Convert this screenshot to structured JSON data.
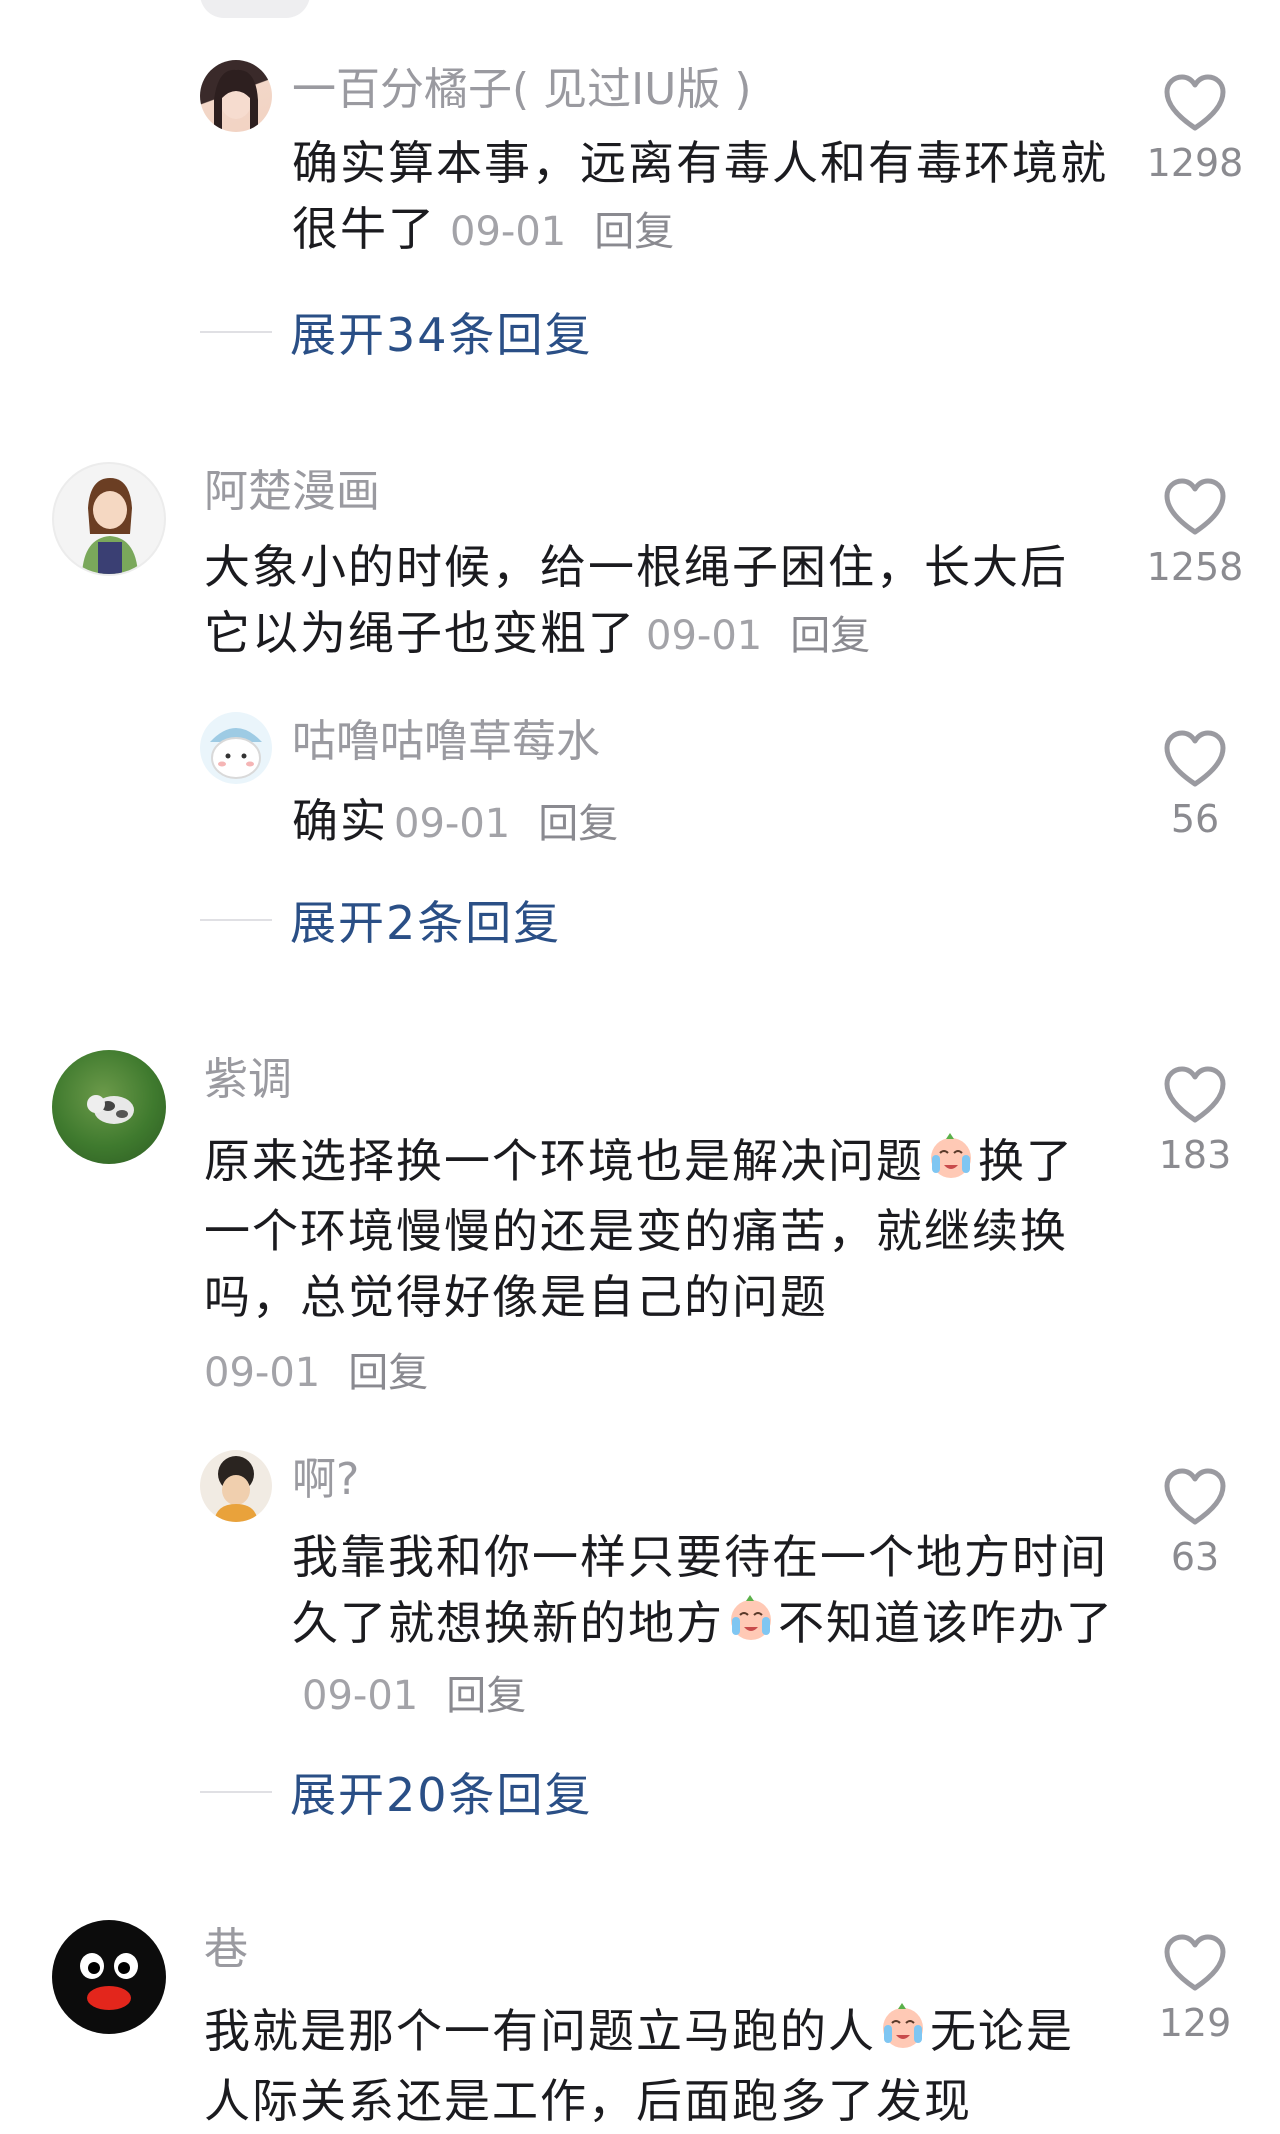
{
  "comments": [
    {
      "name": "一百分橘子( 见过IU版 )",
      "text": "确实算本事，远离有毒人和有毒环境就很牛了",
      "date": "09-01",
      "reply": "回复",
      "likes": "1298",
      "expand": "展开34条回复"
    },
    {
      "name": "阿楚漫画",
      "text": "大象小的时候，给一根绳子困住，长大后它以为绳子也变粗了",
      "date": "09-01",
      "reply": "回复",
      "likes": "1258",
      "sub": {
        "name": "咕噜咕噜草莓水",
        "text": "确实",
        "date": "09-01",
        "reply": "回复",
        "likes": "56"
      },
      "expand": "展开2条回复"
    },
    {
      "name": "紫调",
      "text_a": "原来选择换一个环境也是解决问题",
      "text_b": "换了一个环境慢慢的还是变的痛苦，就继续换吗，总觉得好像是自己的问题",
      "date": "09-01",
      "reply": "回复",
      "likes": "183",
      "sub": {
        "name": "啊?",
        "text_a": "我靠我和你一样只要待在一个地方时间久了就想换新的地方",
        "text_b": "不知道该咋办了",
        "date": "09-01",
        "reply": "回复",
        "likes": "63"
      },
      "expand": "展开20条回复"
    },
    {
      "name": "巷",
      "text_a": "我就是那个一有问题立马跑的人",
      "text_b": "无论是人际关系还是工作，后面跑多了发现",
      "likes": "129"
    }
  ],
  "icons": {
    "like": "heart-outline-icon",
    "emoji1": "crying-emoji",
    "emoji2": "crying-emoji"
  },
  "colors": {
    "expand_link": "#2a4f86",
    "meta_text": "#a3a3a8",
    "heart_stroke": "#9a9aa0"
  }
}
